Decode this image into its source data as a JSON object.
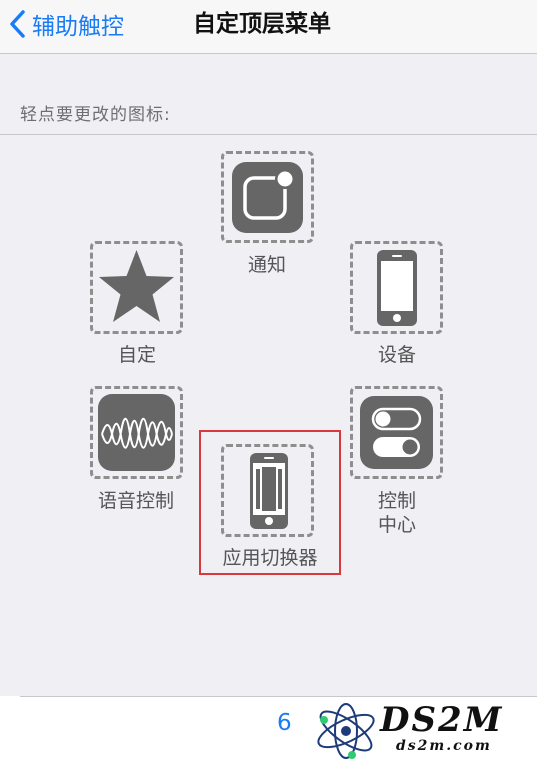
{
  "navbar": {
    "back_label": "辅助触控",
    "title": "自定顶层菜单"
  },
  "section": {
    "label": "轻点要更改的图标:"
  },
  "slots": {
    "notification": {
      "label": "通知",
      "icon": "notification-icon"
    },
    "custom": {
      "label": "自定",
      "icon": "star-icon"
    },
    "device": {
      "label": "设备",
      "icon": "iphone-icon"
    },
    "voice_control": {
      "label": "语音控制",
      "icon": "waveform-icon"
    },
    "control_center": {
      "label_line1": "控制",
      "label_line2": "中心",
      "icon": "toggle-switches-icon"
    },
    "app_switcher": {
      "label": "应用切换器",
      "icon": "app-switcher-icon"
    }
  },
  "footer": {
    "icon_count": "6"
  },
  "watermark": {
    "main": "DS2M",
    "sub": "ds2m.com"
  },
  "colors": {
    "accent": "#1a7cf5",
    "icon_tile": "#666666",
    "highlight": "#d9393d"
  }
}
